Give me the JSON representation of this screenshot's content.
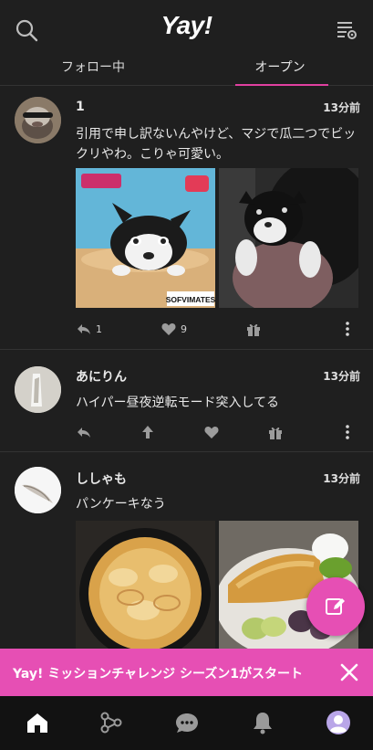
{
  "app": {
    "logo": "Yay!"
  },
  "header": {
    "search_icon": "search-icon",
    "filter_icon": "filter-settings-icon"
  },
  "tabs": [
    {
      "label": "フォロー中",
      "active": false
    },
    {
      "label": "オープン",
      "active": true
    }
  ],
  "colors": {
    "accent": "#e64fb4",
    "tab_underline": "#e040a0",
    "background": "#1f1f1f",
    "bottom_nav": "#121212"
  },
  "posts": [
    {
      "username": "1",
      "time": "13分前",
      "text": "引用で申し訳ないんやけど、マジで瓜二つでビックリやわ。こりゃ可愛い。",
      "images": [
        {
          "caption": "SOFVIMATES",
          "kind": "figure-toy"
        },
        {
          "kind": "dog-photo"
        }
      ],
      "actions": {
        "reply_count": "1",
        "like_count": "9"
      }
    },
    {
      "username": "あにりん",
      "time": "13分前",
      "text": "ハイパー昼夜逆転モード突入してる",
      "actions": {}
    },
    {
      "username": "ししゃも",
      "time": "13分前",
      "text": "パンケーキなう",
      "images": [
        {
          "kind": "pancake-pan"
        },
        {
          "kind": "pancake-plate"
        }
      ]
    }
  ],
  "banner": {
    "text": "Yay! ミッションチャレンジ シーズン1がスタート"
  },
  "bottom_nav": [
    "home-icon",
    "discover-icon",
    "chat-icon",
    "notifications-icon",
    "profile-avatar"
  ]
}
